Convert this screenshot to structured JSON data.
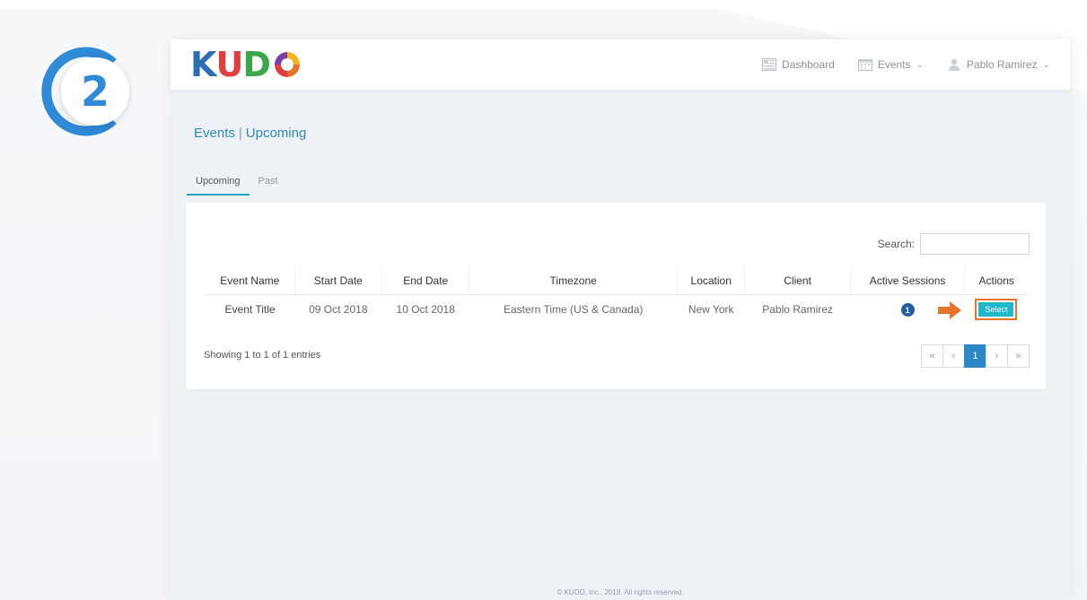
{
  "step": {
    "number": "2"
  },
  "header": {
    "logo_text": [
      "K",
      "U",
      "D"
    ],
    "nav": {
      "dashboard": "Dashboard",
      "events": "Events",
      "user": "Pablo Ramirez"
    }
  },
  "breadcrumb": {
    "section": "Events",
    "separator": "|",
    "page": "Upcoming"
  },
  "tabs": [
    {
      "label": "Upcoming",
      "active": true
    },
    {
      "label": "Past",
      "active": false
    }
  ],
  "search": {
    "label": "Search:",
    "value": ""
  },
  "table": {
    "columns": [
      "Event Name",
      "Start Date",
      "End Date",
      "Timezone",
      "Location",
      "Client",
      "Active Sessions",
      "Actions"
    ],
    "rows": [
      {
        "event_name": "Event Title",
        "start_date": "09 Oct 2018",
        "end_date": "10 Oct 2018",
        "timezone": "Eastern Time (US & Canada)",
        "location": "New York",
        "client": "Pablo Ramirez",
        "active_sessions": "1",
        "action_label": "Select"
      }
    ]
  },
  "summary": "Showing 1 to 1 of 1 entries",
  "pagination": {
    "first": "«",
    "prev": "‹",
    "current": "1",
    "next": "›",
    "last": "»"
  },
  "footer": "© KUDO, Inc., 2018. All rights reserved.",
  "colors": {
    "accent": "#22a6c3",
    "highlight": "#e8742b",
    "badge_blue": "#2f8ad8",
    "page_active": "#2d88c6"
  }
}
